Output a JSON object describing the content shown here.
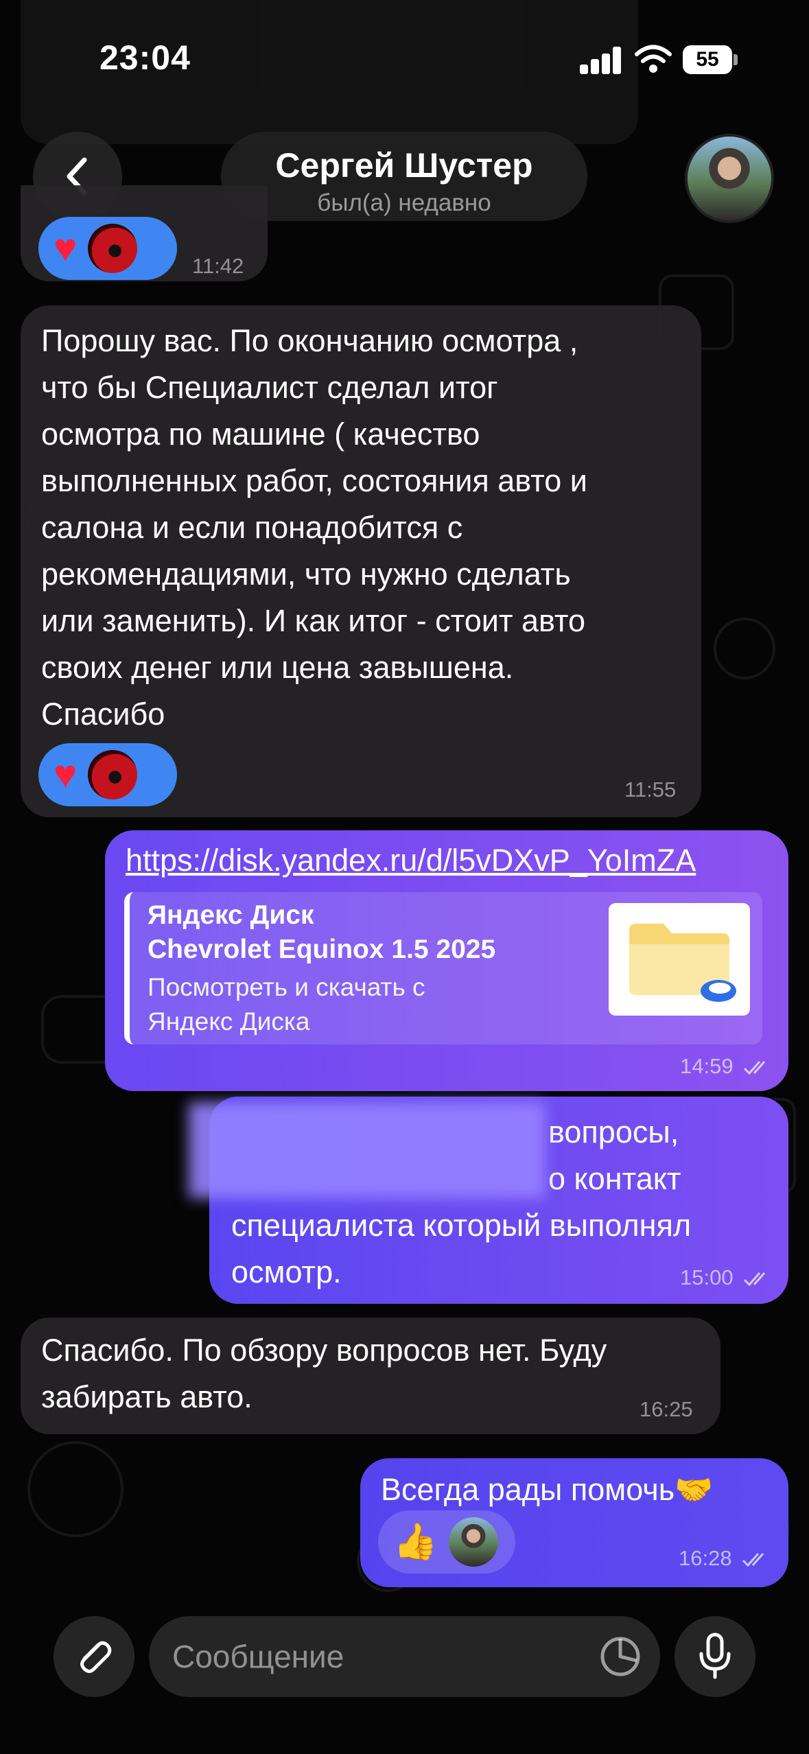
{
  "status_bar": {
    "time": "23:04",
    "battery": "55"
  },
  "header": {
    "contact_name": "Сергей Шустер",
    "status": "был(а) недавно"
  },
  "messages": [
    {
      "direction": "incoming",
      "time": "11:42",
      "reactions": [
        "heart",
        "sender-avatar"
      ]
    },
    {
      "direction": "incoming",
      "text": "Порошу вас. По окончанию осмотра ,\nчто бы Специалист сделал итог\nосмотра по машине ( качество\nвыполненных работ, состояния авто и\nсалона и если понадобится с\nрекомендациями, что нужно сделать\nили заменить). И как итог - стоит авто\nсвоих денег или цена завышена.\nСпасибо",
      "time": "11:55",
      "reactions": [
        "heart",
        "sender-avatar"
      ]
    },
    {
      "direction": "outgoing",
      "link": "https://disk.yandex.ru/d/l5vDXvP_YoImZA",
      "preview": {
        "site": "Яндекс Диск",
        "title": "Chevrolet Equinox 1.5 2025",
        "description": "Посмотреть и скачать с\nЯндекс Диска"
      },
      "time": "14:59"
    },
    {
      "direction": "outgoing",
      "text_line1": "вопросы,",
      "text_line2": "о контакт",
      "text_line3": "специалиста который выполнял\nосмотр.",
      "time": "15:00"
    },
    {
      "direction": "incoming",
      "text": "Спасибо. По обзору вопросов нет. Буду\nзабирать авто.",
      "time": "16:25"
    },
    {
      "direction": "outgoing",
      "text": "Всегда рады помочь🤝",
      "time": "16:28",
      "reactions": [
        "thumbs-up",
        "own-avatar"
      ]
    }
  ],
  "composer": {
    "placeholder": "Сообщение"
  },
  "colors": {
    "outgoing_bubble": "#7a4ef1",
    "incoming_bubble": "#262426",
    "reaction_pill": "#3f86f3",
    "heart": "#ff1e3c"
  }
}
